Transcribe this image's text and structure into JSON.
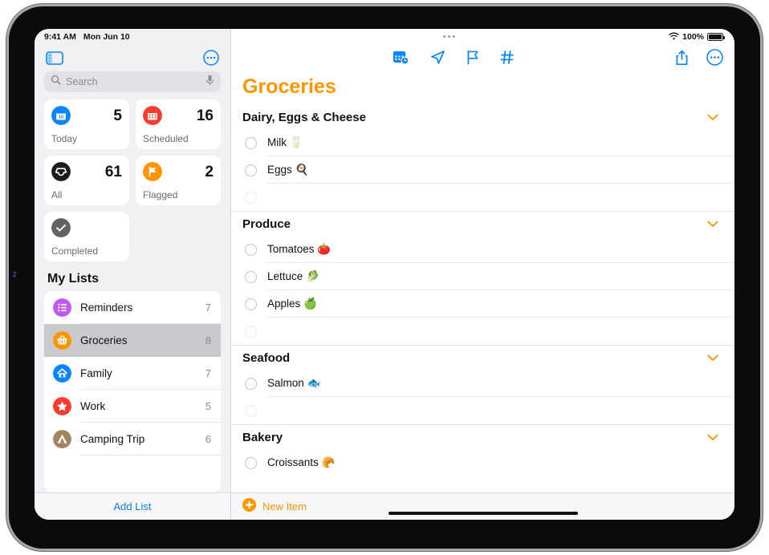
{
  "statusbar": {
    "time": "9:41 AM",
    "date": "Mon Jun 10",
    "battery_percent": "100%",
    "wifi_icon": "wifi-icon",
    "battery_icon": "battery-icon"
  },
  "sidebar": {
    "toggle_icon": "sidebar-toggle-icon",
    "more_icon": "more-circle-icon",
    "search": {
      "placeholder": "Search",
      "search_icon": "search-icon",
      "mic_icon": "microphone-icon"
    },
    "smart_lists": [
      {
        "label": "Today",
        "count": "5",
        "icon": "calendar-day-icon",
        "color": "#0a84ff"
      },
      {
        "label": "Scheduled",
        "count": "16",
        "icon": "calendar-icon",
        "color": "#ff3b30"
      },
      {
        "label": "All",
        "count": "61",
        "icon": "inbox-tray-icon",
        "color": "#1c1c1e"
      },
      {
        "label": "Flagged",
        "count": "2",
        "icon": "flag-icon",
        "color": "#ff9500"
      },
      {
        "label": "Completed",
        "count": "",
        "icon": "checkmark-icon",
        "color": "#636366"
      }
    ],
    "my_lists_title": "My Lists",
    "lists": [
      {
        "name": "Reminders",
        "count": "7",
        "icon": "bullet-list-icon",
        "color": "#bf5af2",
        "selected": false
      },
      {
        "name": "Groceries",
        "count": "8",
        "icon": "basket-icon",
        "color": "#ff9500",
        "selected": true
      },
      {
        "name": "Family",
        "count": "7",
        "icon": "house-icon",
        "color": "#0a84ff",
        "selected": false
      },
      {
        "name": "Work",
        "count": "5",
        "icon": "star-icon",
        "color": "#ff3b30",
        "selected": false
      },
      {
        "name": "Camping Trip",
        "count": "6",
        "icon": "tent-icon",
        "color": "#a2845e",
        "selected": false
      }
    ],
    "add_list_label": "Add List"
  },
  "detail": {
    "multitask_dots": "•••",
    "toolbar": {
      "center_icons": [
        {
          "name": "calendar-clock-icon"
        },
        {
          "name": "location-arrow-icon"
        },
        {
          "name": "flag-icon"
        },
        {
          "name": "hashtag-icon"
        }
      ],
      "share_icon": "share-icon",
      "more_icon": "more-circle-icon"
    },
    "title": "Groceries",
    "accent_color": "#ff9500",
    "sections": [
      {
        "title": "Dairy, Eggs & Cheese",
        "chevron_icon": "chevron-down-icon",
        "items": [
          {
            "text": "Milk 🥛",
            "empty": false
          },
          {
            "text": "Eggs 🍳",
            "empty": false
          },
          {
            "text": "",
            "empty": true
          }
        ]
      },
      {
        "title": "Produce",
        "chevron_icon": "chevron-down-icon",
        "items": [
          {
            "text": "Tomatoes 🍅",
            "empty": false
          },
          {
            "text": "Lettuce 🥬",
            "empty": false
          },
          {
            "text": "Apples 🍏",
            "empty": false
          },
          {
            "text": "",
            "empty": true
          }
        ]
      },
      {
        "title": "Seafood",
        "chevron_icon": "chevron-down-icon",
        "items": [
          {
            "text": "Salmon 🐟",
            "empty": false
          },
          {
            "text": "",
            "empty": true
          }
        ]
      },
      {
        "title": "Bakery",
        "chevron_icon": "chevron-down-icon",
        "items": [
          {
            "text": "Croissants 🥐",
            "empty": false
          }
        ]
      }
    ],
    "new_item_label": "New Item",
    "new_item_icon": "plus-circle-icon"
  },
  "annotation": {
    "marker": "2"
  }
}
